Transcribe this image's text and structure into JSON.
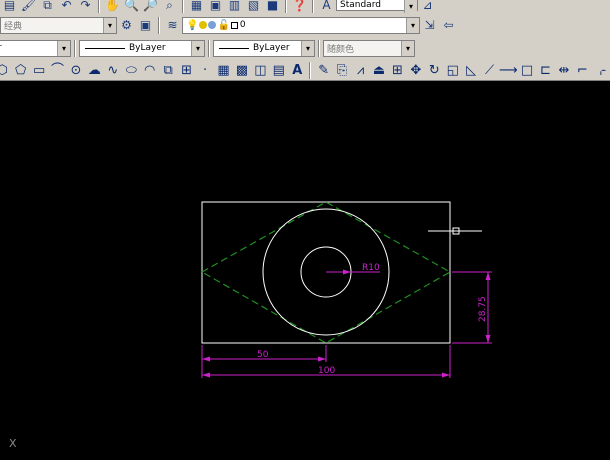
{
  "toolbar": {
    "text_style": "Standard",
    "layer_name": "0",
    "linetype": "ByLayer",
    "lineweight": "ByLayer",
    "plot_color": "随颜色",
    "workspace_partial": "经典"
  },
  "drawing": {
    "radius_label": "R10",
    "dim_half_width": "50",
    "dim_full_width": "100",
    "dim_vertical": "28.75"
  },
  "ucs": {
    "x_label": "X"
  },
  "colors": {
    "toolbar_bg": "#d4d0c8",
    "canvas_bg": "#000000",
    "geometry": "#ffffff",
    "dashed_rhombus": "#1f8f1f",
    "dimensions": "#cc22cc"
  }
}
